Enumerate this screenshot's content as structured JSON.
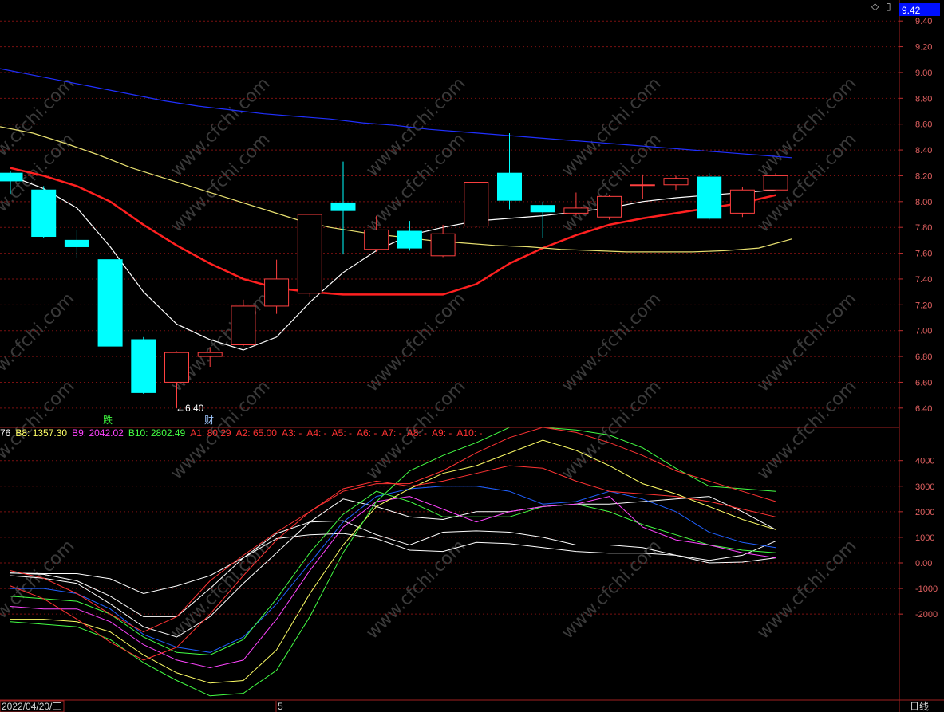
{
  "header": {
    "price_badge": "9.42",
    "diamond_icon": "◇",
    "box_icon": "▯"
  },
  "price_axis_ticks": [
    "9.40",
    "9.20",
    "9.00",
    "8.80",
    "8.60",
    "8.40",
    "8.20",
    "8.00",
    "7.80",
    "7.60",
    "7.40",
    "7.20",
    "7.00",
    "6.80",
    "6.60",
    "6.40"
  ],
  "indicator_axis_ticks": [
    "4000",
    "3000",
    "2000",
    "1000",
    "0.00",
    "-1000",
    "-2000"
  ],
  "indicator_legend": [
    {
      "label": "76",
      "color": "#ffffff"
    },
    {
      "label": "B8: 1357.30",
      "color": "#ffff66"
    },
    {
      "label": "B9: 2042.02",
      "color": "#ff44ff"
    },
    {
      "label": "B10: 2802.49",
      "color": "#44ff44"
    },
    {
      "label": "A1: 80.29",
      "color": "#ff3333"
    },
    {
      "label": "A2: 65.00",
      "color": "#ff3333"
    },
    {
      "label": "A3: -",
      "color": "#ff3333"
    },
    {
      "label": "A4: -",
      "color": "#ff3333"
    },
    {
      "label": "A5: -",
      "color": "#ff3333"
    },
    {
      "label": "A6: -",
      "color": "#ff3333"
    },
    {
      "label": "A7: -",
      "color": "#ff3333"
    },
    {
      "label": "A8: -",
      "color": "#ff3333"
    },
    {
      "label": "A9: -",
      "color": "#ff3333"
    },
    {
      "label": "A10: -",
      "color": "#ff3333"
    }
  ],
  "annotations": {
    "low_label": "←6.40",
    "event_die": "跌",
    "event_cai": "财"
  },
  "bottom_bar": {
    "date": "2022/04/20/三",
    "marker": "5",
    "period": "日线"
  },
  "watermark": "www.cfchi.com",
  "colors": {
    "up": "#ff4040",
    "down": "#00ffff",
    "ma_white": "#ffffff",
    "ma_red": "#ff2020",
    "ma_yellow": "#e8e070",
    "ma_blue": "#2030ff",
    "grid": "#7a1010"
  },
  "chart_data": [
    {
      "type": "candlestick",
      "ylim": [
        6.3,
        9.5
      ],
      "candles": [
        {
          "o": 8.22,
          "h": 8.24,
          "l": 8.06,
          "c": 8.16
        },
        {
          "o": 8.09,
          "h": 8.12,
          "l": 7.72,
          "c": 7.73
        },
        {
          "o": 7.7,
          "h": 7.78,
          "l": 7.56,
          "c": 7.65
        },
        {
          "o": 7.55,
          "h": 7.55,
          "l": 6.88,
          "c": 6.88
        },
        {
          "o": 6.93,
          "h": 6.95,
          "l": 6.51,
          "c": 6.52
        },
        {
          "o": 6.6,
          "h": 6.84,
          "l": 6.4,
          "c": 6.83
        },
        {
          "o": 6.8,
          "h": 6.87,
          "l": 6.72,
          "c": 6.83
        },
        {
          "o": 6.89,
          "h": 7.24,
          "l": 6.88,
          "c": 7.19
        },
        {
          "o": 7.19,
          "h": 7.55,
          "l": 7.13,
          "c": 7.4
        },
        {
          "o": 7.29,
          "h": 7.9,
          "l": 7.26,
          "c": 7.9
        },
        {
          "o": 7.99,
          "h": 8.31,
          "l": 7.59,
          "c": 7.93
        },
        {
          "o": 7.63,
          "h": 7.89,
          "l": 7.61,
          "c": 7.78
        },
        {
          "o": 7.77,
          "h": 7.85,
          "l": 7.62,
          "c": 7.64
        },
        {
          "o": 7.58,
          "h": 7.82,
          "l": 7.57,
          "c": 7.75
        },
        {
          "o": 7.81,
          "h": 8.15,
          "l": 7.8,
          "c": 8.15
        },
        {
          "o": 8.22,
          "h": 8.53,
          "l": 7.94,
          "c": 8.01
        },
        {
          "o": 7.97,
          "h": 8.0,
          "l": 7.72,
          "c": 7.92
        },
        {
          "o": 7.91,
          "h": 8.07,
          "l": 7.89,
          "c": 7.95
        },
        {
          "o": 7.88,
          "h": 8.05,
          "l": 7.86,
          "c": 8.04
        },
        {
          "o": 8.13,
          "h": 8.21,
          "l": 8.02,
          "c": 8.13
        },
        {
          "o": 8.13,
          "h": 8.2,
          "l": 8.09,
          "c": 8.18
        },
        {
          "o": 8.19,
          "h": 8.22,
          "l": 7.86,
          "c": 7.87
        },
        {
          "o": 7.91,
          "h": 8.11,
          "l": 7.88,
          "c": 8.09
        },
        {
          "o": 8.09,
          "h": 8.22,
          "l": 8.08,
          "c": 8.2
        }
      ],
      "series": [
        {
          "color": "#ffffff",
          "values": [
            8.2,
            8.1,
            7.95,
            7.65,
            7.3,
            7.05,
            6.93,
            6.85,
            6.95,
            7.22,
            7.45,
            7.62,
            7.74,
            7.8,
            7.85,
            7.87,
            7.89,
            7.92,
            7.95,
            8.0,
            8.03,
            8.05,
            8.07,
            8.09
          ]
        },
        {
          "color": "#ff2020",
          "values": [
            8.26,
            8.2,
            8.12,
            8.0,
            7.82,
            7.66,
            7.52,
            7.4,
            7.33,
            7.3,
            7.28,
            7.28,
            7.28,
            7.28,
            7.36,
            7.52,
            7.64,
            7.74,
            7.82,
            7.87,
            7.91,
            7.95,
            7.99,
            8.05
          ]
        },
        {
          "color": "#e8e070",
          "values": [
            8.58,
            8.53,
            8.45,
            8.36,
            8.26,
            8.18,
            8.1,
            8.02,
            7.94,
            7.86,
            7.8,
            7.76,
            7.73,
            7.7,
            7.68,
            7.66,
            7.65,
            7.63,
            7.62,
            7.61,
            7.61,
            7.61,
            7.62,
            7.64,
            7.71
          ]
        },
        {
          "color": "#2030ff",
          "values": [
            9.03,
            8.98,
            8.93,
            8.88,
            8.83,
            8.78,
            8.74,
            8.71,
            8.68,
            8.66,
            8.64,
            8.61,
            8.59,
            8.56,
            8.54,
            8.52,
            8.5,
            8.48,
            8.46,
            8.44,
            8.42,
            8.4,
            8.38,
            8.36,
            8.34
          ]
        }
      ]
    },
    {
      "type": "line",
      "ylim": [
        -5300,
        5300
      ],
      "series": [
        {
          "color": "#ffffff",
          "values": [
            -400,
            -420,
            -420,
            -620,
            -1200,
            -900,
            -500,
            200,
            950,
            1100,
            1150,
            950,
            500,
            450,
            800,
            750,
            600,
            450,
            380,
            380,
            300,
            0,
            30,
            200
          ]
        },
        {
          "color": "#ffffff",
          "values": [
            -400,
            -450,
            -700,
            -1300,
            -2100,
            -2100,
            -1000,
            200,
            1150,
            1600,
            1650,
            1100,
            700,
            1200,
            1250,
            1200,
            1000,
            700,
            700,
            600,
            300,
            100,
            300,
            850
          ]
        },
        {
          "color": "#ffffff",
          "values": [
            -500,
            -600,
            -800,
            -1600,
            -2500,
            -2900,
            -2100,
            -800,
            400,
            1600,
            2500,
            2200,
            1800,
            1700,
            2000,
            2000,
            2200,
            2300,
            2300,
            2400,
            2500,
            2600,
            2000,
            1300
          ]
        },
        {
          "color": "#2060ff",
          "values": [
            -1000,
            -1000,
            -1200,
            -1800,
            -2800,
            -3300,
            -3500,
            -2900,
            -1600,
            0,
            1600,
            2600,
            2900,
            3000,
            3000,
            2800,
            2300,
            2400,
            2800,
            2500,
            2000,
            1200,
            800,
            600
          ]
        },
        {
          "color": "#44ff44",
          "values": [
            -1300,
            -1400,
            -1500,
            -2000,
            -2900,
            -3500,
            -3600,
            -3000,
            -1400,
            400,
            1900,
            2800,
            2400,
            1800,
            1800,
            1800,
            2200,
            2300,
            2000,
            1500,
            1100,
            700,
            500,
            400
          ]
        },
        {
          "color": "#ff44ff",
          "values": [
            -1700,
            -1800,
            -1800,
            -2300,
            -3200,
            -3800,
            -4100,
            -3800,
            -2200,
            -300,
            1400,
            2400,
            2600,
            2100,
            1600,
            2000,
            2200,
            2300,
            2600,
            1400,
            900,
            700,
            400,
            200
          ]
        },
        {
          "color": "#ffff66",
          "values": [
            -2200,
            -2200,
            -2300,
            -2700,
            -3600,
            -4300,
            -4700,
            -4600,
            -3400,
            -1200,
            700,
            2200,
            2900,
            3500,
            3800,
            4300,
            4800,
            4400,
            3800,
            3100,
            2700,
            2200,
            1700,
            1300
          ]
        },
        {
          "color": "#44ff44",
          "values": [
            -2300,
            -2400,
            -2500,
            -3000,
            -3900,
            -4600,
            -5200,
            -5100,
            -4200,
            -2100,
            400,
            2400,
            3600,
            4200,
            4700,
            5300,
            5300,
            5200,
            5000,
            4500,
            3700,
            3000,
            2900,
            2800
          ]
        },
        {
          "color": "#ff3333",
          "values": [
            -300,
            -600,
            -1200,
            -2000,
            -2700,
            -2100,
            -700,
            300,
            1200,
            2000,
            2900,
            3200,
            3000,
            3200,
            3500,
            3800,
            3700,
            3200,
            2800,
            2700,
            2600,
            2400,
            2100,
            1800
          ]
        },
        {
          "color": "#ff3333",
          "values": [
            -900,
            -1400,
            -2200,
            -3100,
            -3800,
            -3300,
            -2000,
            -500,
            900,
            2000,
            2800,
            3100,
            3100,
            3600,
            4300,
            4900,
            5300,
            5100,
            4700,
            4200,
            3600,
            3200,
            2800,
            2400
          ]
        }
      ]
    }
  ]
}
